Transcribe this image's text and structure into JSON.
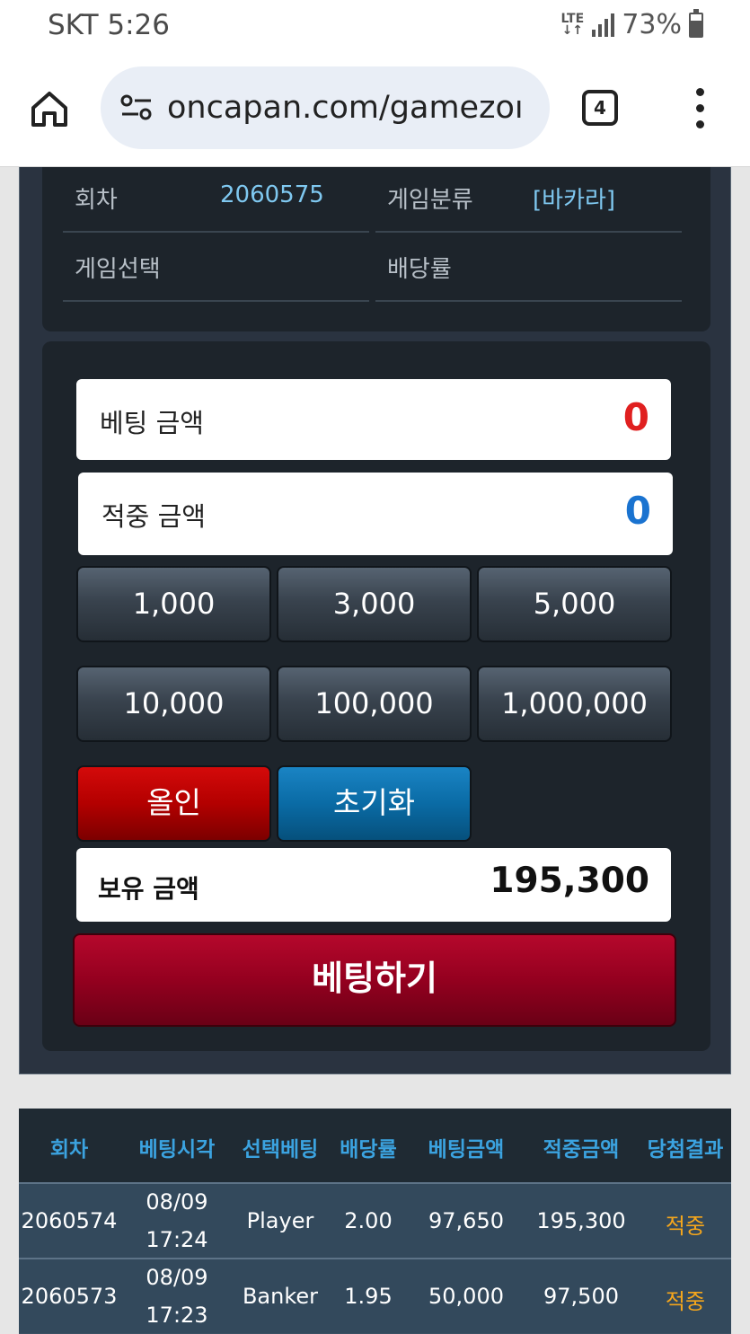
{
  "status_bar": {
    "carrier_time": "SKT 5:26",
    "network": "LTE",
    "battery": "73%"
  },
  "browser": {
    "url": "oncapan.com/gamezoı",
    "tab_count": "4",
    "icons": [
      "home-icon",
      "site-settings-icon",
      "tabs-icon",
      "more-vert-icon"
    ]
  },
  "info": {
    "round_label": "회차",
    "round_value": "2060575",
    "category_label": "게임분류",
    "category_value": "[바카라]",
    "selection_label": "게임선택",
    "odds_label": "배당률"
  },
  "bet": {
    "bet_amount_label": "베팅 금액",
    "bet_amount_value": "0",
    "win_amount_label": "적중 금액",
    "win_amount_value": "0",
    "chips": [
      "1,000",
      "3,000",
      "5,000",
      "10,000",
      "100,000",
      "1,000,000"
    ],
    "allin_label": "올인",
    "reset_label": "초기화",
    "balance_label": "보유 금액",
    "balance_value": "195,300",
    "submit_label": "베팅하기"
  },
  "history": {
    "headers": [
      "회차",
      "베팅시각",
      "선택베팅",
      "배당률",
      "베팅금액",
      "적중금액",
      "당첨결과"
    ],
    "rows": [
      {
        "round": "2060574",
        "date": "08/09",
        "time": "17:24",
        "pick": "Player",
        "odds": "2.00",
        "bet": "97,650",
        "win": "195,300",
        "result": "적중"
      },
      {
        "round": "2060573",
        "date": "08/09",
        "time": "17:23",
        "pick": "Banker",
        "odds": "1.95",
        "bet": "50,000",
        "win": "97,500",
        "result": "적중"
      }
    ]
  },
  "colors": {
    "bet_amount": "#e02020",
    "win_amount": "#1a73d0",
    "result": "#f5a61c",
    "header_text": "#3ba3e0"
  }
}
